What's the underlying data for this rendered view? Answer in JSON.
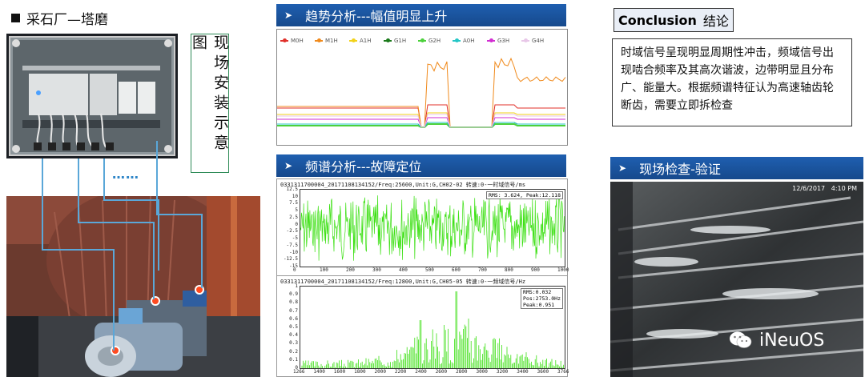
{
  "site": {
    "title": "采石厂—塔磨"
  },
  "install_caption": "现场安装示意图",
  "dots": "……",
  "trend": {
    "header": "趋势分析---幅值明显上升",
    "legend": [
      {
        "label": "M0H",
        "color": "#e0302a"
      },
      {
        "label": "M1H",
        "color": "#f08a1c"
      },
      {
        "label": "A1H",
        "color": "#f2d21a"
      },
      {
        "label": "G1H",
        "color": "#1a7a1a"
      },
      {
        "label": "G2H",
        "color": "#4cd13c"
      },
      {
        "label": "A0H",
        "color": "#25c6c6"
      },
      {
        "label": "G3H",
        "color": "#d22ed2"
      },
      {
        "label": "G4H",
        "color": "#e8c7e8"
      }
    ]
  },
  "spectrum": {
    "header": "频谱分析---故障定位",
    "time_title": "0331311700004_20171108134152/Freq:25600,Unit:G,CH02-02 转速:0-一时域信号/ms",
    "time_info": "RMS: 3.624, Peak:12.118",
    "time_yticks": [
      "12.5",
      "10",
      "7.5",
      "5",
      "2.5",
      "0",
      "-2.5",
      "-5",
      "-7.5",
      "-10",
      "-12.5",
      "-15"
    ],
    "time_xticks": [
      "0",
      "100",
      "200",
      "300",
      "400",
      "500",
      "600",
      "700",
      "800",
      "900",
      "1000"
    ],
    "freq_title": "0331311700004_20171108134152/Freq:12800,Unit:G,CH05-05 转速:0-一频域信号/Hz",
    "freq_info": [
      "RMS:0.032",
      "Pos:2753.0Hz",
      "Peak:0.951"
    ],
    "freq_yticks": [
      "1",
      "0.9",
      "0.8",
      "0.7",
      "0.6",
      "0.5",
      "0.4",
      "0.3",
      "0.2",
      "0.1",
      "0"
    ],
    "freq_xticks": [
      "1266",
      "1400",
      "1600",
      "1800",
      "2000",
      "2200",
      "2400",
      "2600",
      "2800",
      "3000",
      "3200",
      "3400",
      "3600",
      "3766"
    ]
  },
  "conclusion": {
    "title_en": "Conclusion",
    "title_zh": "结论",
    "body": "时域信号呈现明显周期性冲击，频域信号出现啮合频率及其高次谐波，边带明显且分布广、能量大。根据频谱特征认为高速轴齿轮断齿，需要立即拆检查"
  },
  "inspection": {
    "header": "现场检查-验证",
    "timestamp": "12/6/2017   4:10 PM"
  },
  "watermark": "iNeuOS",
  "colors": {
    "header_blue": "#1a53a0",
    "signal_green": "#3be012",
    "caption_border": "#2e8b57"
  }
}
